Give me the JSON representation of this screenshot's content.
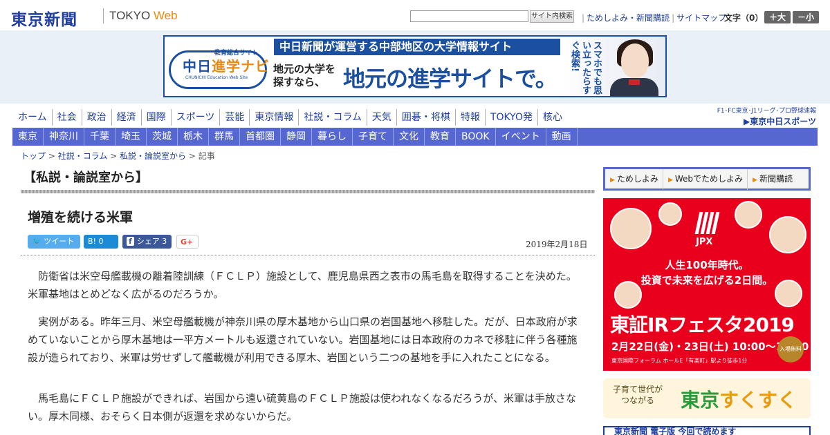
{
  "header": {
    "logo": "東京新聞",
    "logo_sub_a": "TOKYO",
    "logo_sub_b": "Web",
    "search_button": "サイト内検索",
    "links": [
      "ためしよみ・新聞購読",
      "サイトマップ"
    ],
    "font_size_label": "文字（0）",
    "font_increase": "＋大",
    "font_decrease": "－小"
  },
  "banner": {
    "logo_small": "教育総合サイト",
    "logo_text_a": "中日",
    "logo_text_b": "進学ナビ",
    "logo_sub": "CHUNICHI Education Web Site",
    "headline": "中日新聞が運営する中部地区の大学情報サイト",
    "left_copy_1": "地元の大学を",
    "left_copy_2": "探すなら、",
    "big_copy": "地元の進学サイトで。",
    "vertical_copy": "スマホでも思い立ったらすぐ検索!"
  },
  "nav_primary": [
    "ホーム",
    "社会",
    "政治",
    "経済",
    "国際",
    "スポーツ",
    "芸能",
    "東京情報",
    "社説・コラム",
    "天気",
    "囲碁・将棋",
    "特報",
    "TOKYO発",
    "核心"
  ],
  "chunichi": {
    "line1": "F1･FC東京･J1リーグ･プロ野球速報",
    "line2": "▶東京中日スポーツ"
  },
  "nav_regional": [
    "東京",
    "神奈川",
    "千葉",
    "埼玉",
    "茨城",
    "栃木",
    "群馬",
    "首都圏",
    "静岡",
    "暮らし",
    "子育て",
    "文化",
    "教育",
    "BOOK",
    "イベント",
    "動画"
  ],
  "breadcrumb": {
    "items": [
      "トップ",
      "社説・コラム",
      "私説・論説室から"
    ],
    "current": "記事",
    "sep": " > "
  },
  "article": {
    "section": "【私説・論説室から】",
    "title": "増殖を続ける米軍",
    "date": "2019年2月18日",
    "share": {
      "tweet": "ツイート",
      "hatena": "B! 0",
      "facebook": "シェア 3",
      "gplus": "G+"
    },
    "paragraphs": [
      "防衛省は米空母艦載機の離着陸訓練（ＦＣＬＰ）施設として、鹿児島県西之表市の馬毛島を取得することを決めた。米軍基地はとめどなく広がるのだろうか。",
      "実例がある。昨年三月、米空母艦載機が神奈川県の厚木基地から山口県の岩国基地へ移駐した。だが、日本政府が求めていないことから厚木基地は一平方メートルも返還されていない。岩国基地には日本政府のカネで移駐に伴う各種施設が造られており、米軍は労せずして艦載機が利用できる厚木、岩国という二つの基地を手に入れたことになる。",
      "馬毛島にＦＣＬＰ施設ができれば、岩国から遠い硫黄島のＦＣＬＰ施設は使われなくなるだろうが、米軍は手放さない。厚木同様、おそらく日本側が返還を求めないからだ。"
    ]
  },
  "sidebar": {
    "subscribe_links": [
      "ためしよみ",
      "Webでためしよみ",
      "新聞購読"
    ],
    "jpx_ad": {
      "logo": "JPX",
      "line1": "人生100年時代。",
      "line2": "投資で未来を広げる2日間。",
      "festa": "東証IRフェスタ2019",
      "date": "2月22日(金)・23日(土) 10:00～18:00",
      "place": "東京国際フォーラム ホールE「有楽町」駅より徒歩1分",
      "free": "入場無料"
    },
    "suku_ad": {
      "small_1": "子育て世代が",
      "small_2": "つながる",
      "big_a": "東京",
      "big_b": "すくすく"
    },
    "bottom_ad": "東京新聞 電子版 今回で読めます"
  }
}
